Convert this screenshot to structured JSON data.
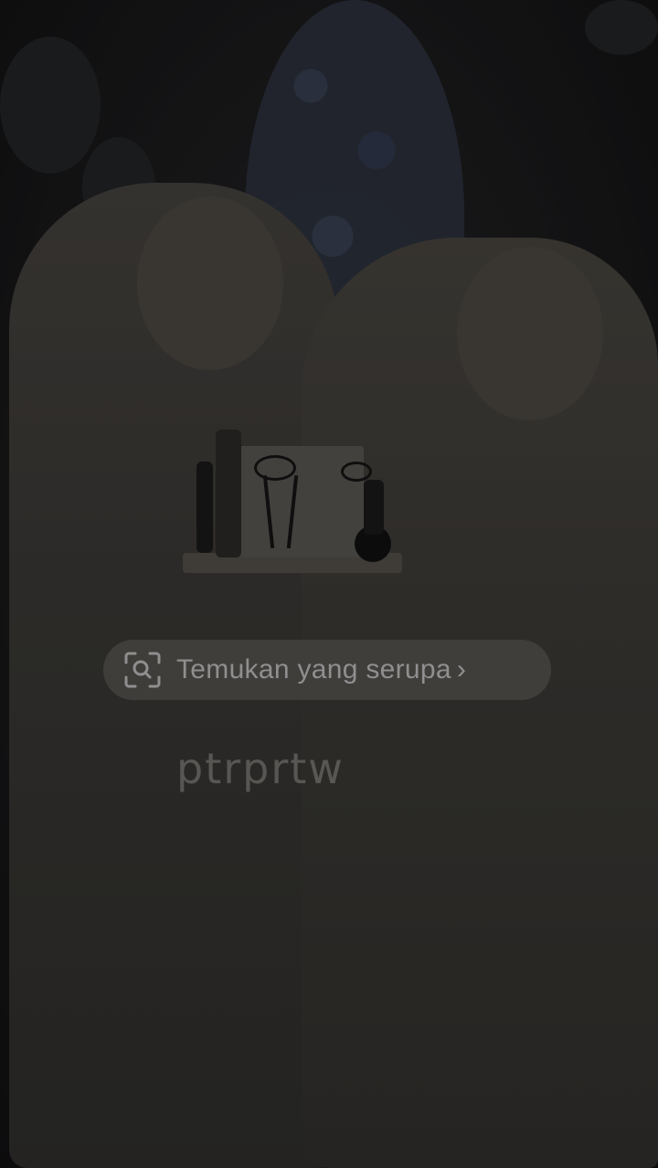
{
  "visual_search": {
    "label": "Temukan yang serupa",
    "icon": "visual-search-icon",
    "chevron": "›"
  },
  "photo": {
    "subject": "photo-two-women-holding-cake",
    "watermark": "ptrprtw"
  },
  "colors": {
    "overlay": "#141414",
    "pill": "#504e4a",
    "text": "#8f8f8f"
  }
}
